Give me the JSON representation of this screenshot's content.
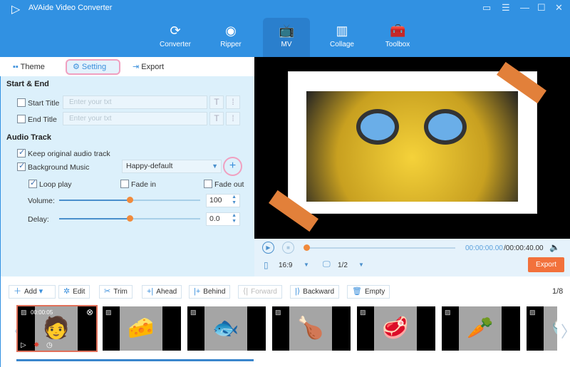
{
  "app": {
    "title": "AVAide Video Converter",
    "accent": "#3191e2"
  },
  "nav": [
    {
      "label": "Converter",
      "icon": "converter-icon"
    },
    {
      "label": "Ripper",
      "icon": "ripper-icon"
    },
    {
      "label": "MV",
      "icon": "mv-icon",
      "active": true
    },
    {
      "label": "Collage",
      "icon": "collage-icon"
    },
    {
      "label": "Toolbox",
      "icon": "toolbox-icon"
    }
  ],
  "tabs": {
    "theme": "Theme",
    "setting": "Setting",
    "export": "Export"
  },
  "start_end": {
    "heading": "Start & End",
    "start_title": "Start Title",
    "end_title": "End Title",
    "placeholder": "Enter your txt"
  },
  "audio": {
    "heading": "Audio Track",
    "keep_original": "Keep original audio track",
    "background_music": "Background Music",
    "music_value": "Happy-default",
    "loop_play": "Loop play",
    "fade_in": "Fade in",
    "fade_out": "Fade out",
    "volume_label": "Volume:",
    "volume_value": "100",
    "volume_level": 0.5,
    "delay_label": "Delay:",
    "delay_value": "0.0",
    "delay_level": 0.5
  },
  "player": {
    "time": "00:00:00.00",
    "duration": "/00:00:40.00",
    "ratio": "16:9",
    "screen": "1/2",
    "export": "Export",
    "progress": 0
  },
  "toolbar": {
    "add": "Add",
    "edit": "Edit",
    "trim": "Trim",
    "ahead": "Ahead",
    "behind": "Behind",
    "forward": "Forward",
    "backward": "Backward",
    "empty": "Empty",
    "page": "1/8"
  },
  "clips": [
    {
      "time": "00:00:05",
      "emoji": "🧑"
    },
    {
      "emoji": "🧀"
    },
    {
      "emoji": "🐟"
    },
    {
      "emoji": "🍗"
    },
    {
      "emoji": "🥩"
    },
    {
      "emoji": "🥕"
    },
    {
      "emoji": "🍚"
    }
  ]
}
